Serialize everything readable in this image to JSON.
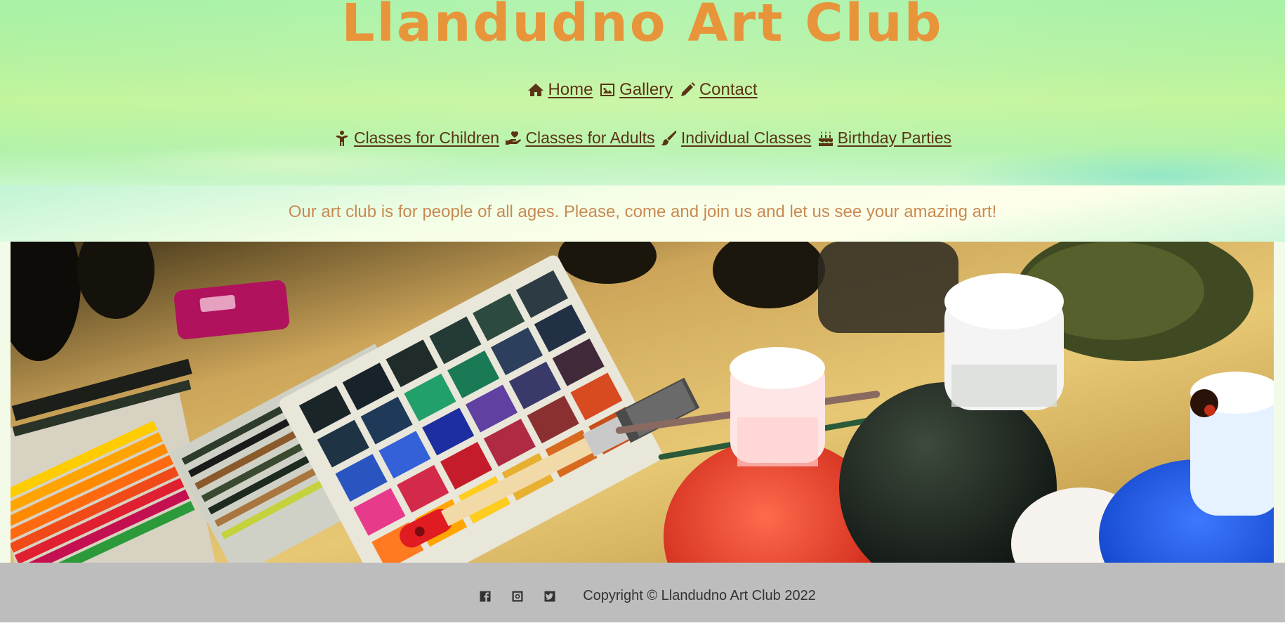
{
  "site": {
    "title": "Llandudno Art Club"
  },
  "nav_primary": [
    {
      "label": " Home",
      "icon": "home-icon"
    },
    {
      "label": " Gallery",
      "icon": "image-icon"
    },
    {
      "label": " Contact",
      "icon": "pencil-icon"
    }
  ],
  "nav_secondary": [
    {
      "label": " Classes for Children",
      "icon": "child-icon"
    },
    {
      "label": " Classes for Adults",
      "icon": "hand-holding-heart-icon"
    },
    {
      "label": " Individual Classes",
      "icon": "paint-brush-icon"
    },
    {
      "label": " Birthday Parties",
      "icon": "birthday-cake-icon"
    }
  ],
  "tagline": "Our art club is for people of all ages. Please, come and join us and let us see your amazing art!",
  "hero": {
    "description_icon": "art-supplies-photo"
  },
  "footer": {
    "social": [
      "facebook-icon",
      "instagram-icon",
      "twitter-icon"
    ],
    "copyright": "Copyright © Llandudno Art Club 2022"
  },
  "colors": {
    "title": "#e8943a",
    "nav_text": "#5a3414",
    "tagline": "#c88a52",
    "footer_bg": "#bdbdbd"
  }
}
